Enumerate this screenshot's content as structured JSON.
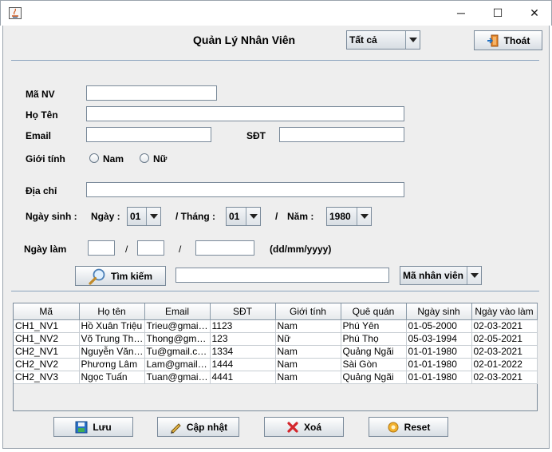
{
  "app": {
    "title": "Quản Lý Nhân Viên"
  },
  "window": {
    "minimize_glyph": "─",
    "maximize_glyph": "☐",
    "close_glyph": "✕"
  },
  "header": {
    "filter_combo": "Tất cả",
    "exit_label": "Thoát"
  },
  "form": {
    "ma_nv_label": "Mã NV",
    "ho_ten_label": "Họ Tên",
    "email_label": "Email",
    "sdt_label": "SĐT",
    "gioi_tinh_label": "Giới tính",
    "nam_label": "Nam",
    "nu_label": "Nữ",
    "dia_chi_label": "Địa chỉ",
    "ngay_sinh_label": "Ngày sinh :",
    "ngay_label": "Ngày :",
    "ngay_value": "01",
    "thang_label": "/ Tháng :",
    "thang_value": "01",
    "slash": "/",
    "nam_label_date": "Năm :",
    "nam_value": "1980",
    "ngay_lam_label": "Ngày làm",
    "date_format": "(dd/mm/yyyy)"
  },
  "search": {
    "button_label": "Tìm kiếm",
    "field_combo": "Mã nhân viên"
  },
  "table": {
    "columns": [
      "Mã",
      "Họ tên",
      "Email",
      "SĐT",
      "Giới tính",
      "Quê quán",
      "Ngày sinh",
      "Ngày vào làm"
    ],
    "rows": [
      [
        "CH1_NV1",
        "Hồ Xuân Triệu",
        "Trieu@gmail.com",
        "1123",
        "Nam",
        "Phú Yên",
        "01-05-2000",
        "02-03-2021"
      ],
      [
        "CH1_NV2",
        "Võ Trung Thông",
        "Thong@gmail.com",
        "123",
        "Nữ",
        "Phú Thọ",
        "05-03-1994",
        "02-05-2021"
      ],
      [
        "CH2_NV1",
        "Nguyễn Văn Tú",
        "Tu@gmail.com",
        "1334",
        "Nam",
        "Quảng Ngãi",
        "01-01-1980",
        "02-03-2021"
      ],
      [
        "CH2_NV2",
        "Phương Lâm",
        "Lam@gmail.com",
        "1444",
        "Nam",
        "Sài Gòn",
        "01-01-1980",
        "02-01-2022"
      ],
      [
        "CH2_NV3",
        "Ngọc Tuấn",
        "Tuan@gmail.com",
        "4441",
        "Nam",
        "Quảng Ngãi",
        "01-01-1980",
        "02-03-2021"
      ]
    ]
  },
  "actions": {
    "save_label": "Lưu",
    "update_label": "Cập nhật",
    "delete_label": "Xoá",
    "reset_label": "Reset"
  },
  "colors": {
    "panel_bg": "#eeeeee",
    "separator": "#8aa3bd",
    "delete_x": "#d4262c"
  }
}
